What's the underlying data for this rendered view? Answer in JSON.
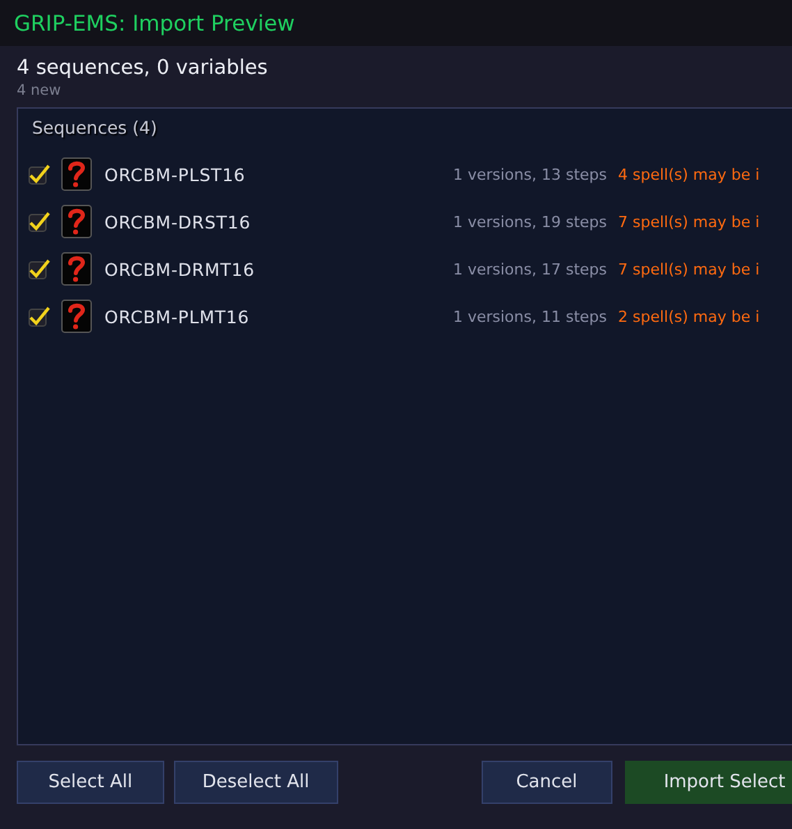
{
  "window": {
    "title": "GRIP-EMS: Import Preview"
  },
  "summary": {
    "heading": "4 sequences, 0 variables",
    "subheading": "4 new"
  },
  "panel": {
    "title": "Sequences (4)",
    "rows": [
      {
        "name": "ORCBM-PLST16",
        "checked": true,
        "details": "1 versions, 13 steps",
        "warning": "4 spell(s) may be i"
      },
      {
        "name": "ORCBM-DRST16",
        "checked": true,
        "details": "1 versions, 19 steps",
        "warning": "7 spell(s) may be i"
      },
      {
        "name": "ORCBM-DRMT16",
        "checked": true,
        "details": "1 versions, 17 steps",
        "warning": "7 spell(s) may be i"
      },
      {
        "name": "ORCBM-PLMT16",
        "checked": true,
        "details": "1 versions, 11 steps",
        "warning": "2 spell(s) may be i"
      }
    ]
  },
  "buttons": [
    {
      "label": "Select All",
      "kind": "secondary"
    },
    {
      "label": "Deselect All",
      "kind": "secondary"
    },
    {
      "label": "Cancel",
      "kind": "secondary"
    },
    {
      "label": "Import Select",
      "kind": "primary"
    }
  ]
}
